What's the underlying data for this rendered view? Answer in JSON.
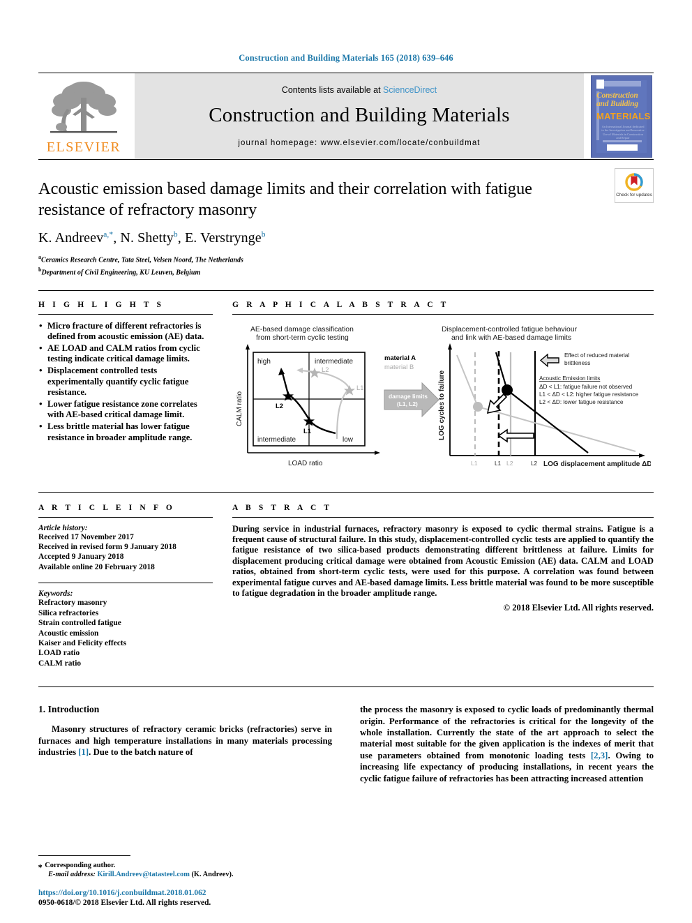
{
  "running_head": "Construction and Building Materials 165 (2018) 639–646",
  "masthead": {
    "contents_prefix": "Contents lists available at ",
    "sciencedirect": "ScienceDirect",
    "journal_title": "Construction and Building Materials",
    "homepage": "journal homepage: www.elsevier.com/locate/conbuildmat",
    "publisher_logo_text": "ELSEVIER",
    "cover": {
      "line1": "Construction",
      "line2": "and Building",
      "line3": "MATERIALS",
      "subtitle": "An International Journal dedicated to the Investigation and Innovative Use of Materials in Construction and Repair"
    }
  },
  "article": {
    "title": "Acoustic emission based damage limits and their correlation with fatigue resistance of refractory masonry",
    "authors_html": "K. Andreev<sup>a,*</sup>, N. Shetty<sup>b</sup>, E. Verstrynge<sup>b</sup>",
    "affiliation_a": "Ceramics Research Centre, Tata Steel, Velsen Noord, The Netherlands",
    "affiliation_b": "Department of Civil Engineering, KU Leuven, Belgium",
    "check_updates": "Check for updates"
  },
  "highlights": {
    "heading": "H I G H L I G H T S",
    "items": [
      "Micro fracture of different refractories is defined from acoustic emission (AE) data.",
      "AE LOAD and CALM ratios from cyclic testing indicate critical damage limits.",
      "Displacement controlled tests experimentally quantify cyclic fatigue resistance.",
      "Lower fatigue resistance zone correlates with AE-based critical damage limit.",
      "Less brittle material has lower fatigue resistance in broader amplitude range."
    ]
  },
  "graphical_abstract": {
    "heading": "G R A P H I C A L   A B S T R A C T",
    "left_chart": {
      "title_line1": "AE-based damage classification",
      "title_line2": "from short-term cyclic testing",
      "xlabel": "LOAD ratio",
      "ylabel": "CALM ratio",
      "quadrant_top_left": "high",
      "quadrant_top_right": "intermediate",
      "quadrant_bottom_left": "intermediate",
      "quadrant_bottom_right": "low",
      "legend_a": "material A",
      "legend_b": "material B",
      "marker_a_l1": "L1",
      "marker_a_l2": "L2",
      "marker_b_l1": "L1",
      "marker_b_l2": "L2"
    },
    "arrow": {
      "line1": "damage limits",
      "line2": "(L1, L2)"
    },
    "right_chart": {
      "title_line1": "Displacement-controlled fatigue behaviour",
      "title_line2": "and link with AE-based damage limits",
      "xlabel": "LOG displacement amplitude ΔD",
      "ylabel": "LOG cycles to failure",
      "note_line1": "Effect of reduced material",
      "note_line2": "brittleness",
      "limits_heading": "Acoustic Emission limits",
      "limit_1": "ΔD < L1: fatigue failure not observed",
      "limit_2": "L1 < ΔD < L2: higher fatigue resistance",
      "limit_3": "L2 < ΔD: lower fatigue resistance",
      "ticks": [
        "L1",
        "L1",
        "L2",
        "L2"
      ]
    }
  },
  "article_info": {
    "heading": "A R T I C L E   I N F O",
    "history_label": "Article history:",
    "history": [
      "Received 17 November 2017",
      "Received in revised form 9 January 2018",
      "Accepted 9 January 2018",
      "Available online 20 February 2018"
    ],
    "keywords_label": "Keywords:",
    "keywords": [
      "Refractory masonry",
      "Silica refractories",
      "Strain controlled fatigue",
      "Acoustic emission",
      "Kaiser and Felicity effects",
      "LOAD ratio",
      "CALM ratio"
    ]
  },
  "abstract": {
    "heading": "A B S T R A C T",
    "body": "During service in industrial furnaces, refractory masonry is exposed to cyclic thermal strains. Fatigue is a frequent cause of structural failure. In this study, displacement-controlled cyclic tests are applied to quantify the fatigue resistance of two silica-based products demonstrating different brittleness at failure. Limits for displacement producing critical damage were obtained from Acoustic Emission (AE) data. CALM and LOAD ratios, obtained from short-term cyclic tests, were used for this purpose. A correlation was found between experimental fatigue curves and AE-based damage limits. Less brittle material was found to be more susceptible to fatigue degradation in the broader amplitude range.",
    "copyright": "© 2018 Elsevier Ltd. All rights reserved."
  },
  "body": {
    "section_heading": "1. Introduction",
    "left_paragraph_part1": "Masonry structures of refractory ceramic bricks (refractories) serve in furnaces and high temperature installations in many materials processing industries ",
    "left_ref1": "[1]",
    "left_paragraph_part2": ". Due to the batch nature of",
    "right_paragraph_part1": "the process the masonry is exposed to cyclic loads of predominantly thermal origin. Performance of the refractories is critical for the longevity of the whole installation. Currently the state of the art approach to select the material most suitable for the given application is the indexes of merit that use parameters obtained from monotonic loading tests ",
    "right_ref1": "[2,3]",
    "right_paragraph_part2": ". Owing to increasing life expectancy of producing installations, in recent years the cyclic fatigue failure of refractories has been attracting increased attention"
  },
  "footnote": {
    "corresponding": "Corresponding author.",
    "email_label": "E-mail address:",
    "email": "Kirill.Andreev@tatasteel.com",
    "email_suffix": "(K. Andreev)."
  },
  "footer": {
    "doi": "https://doi.org/10.1016/j.conbuildmat.2018.01.062",
    "issn": "0950-0618/© 2018 Elsevier Ltd. All rights reserved."
  }
}
